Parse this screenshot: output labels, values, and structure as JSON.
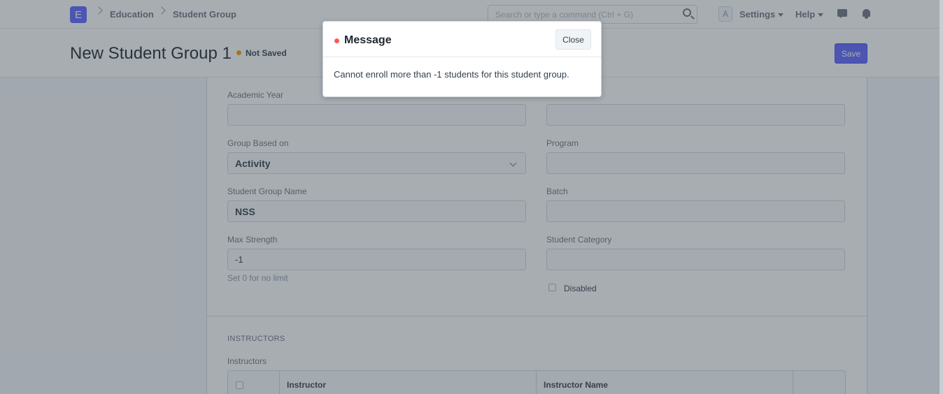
{
  "navbar": {
    "logo_letter": "E",
    "breadcrumbs": [
      "Education",
      "Student Group"
    ],
    "search_placeholder": "Search or type a command (Ctrl + G)",
    "avatar_letter": "A",
    "settings_label": "Settings",
    "help_label": "Help"
  },
  "page_head": {
    "title": "New Student Group 1",
    "status": "Not Saved",
    "save_label": "Save"
  },
  "form": {
    "academic_year": {
      "label": "Academic Year",
      "value": ""
    },
    "academic_term": {
      "label": "",
      "value": ""
    },
    "group_based_on": {
      "label": "Group Based on",
      "value": "Activity"
    },
    "program": {
      "label": "Program",
      "value": ""
    },
    "student_group_name": {
      "label": "Student Group Name",
      "value": "NSS"
    },
    "batch": {
      "label": "Batch",
      "value": ""
    },
    "max_strength": {
      "label": "Max Strength",
      "value": "-1",
      "help": "Set 0 for no limit"
    },
    "student_category": {
      "label": "Student Category",
      "value": ""
    },
    "disabled": {
      "label": "Disabled",
      "checked": false
    }
  },
  "instructors_section": {
    "heading": "INSTRUCTORS",
    "table_label": "Instructors",
    "columns": [
      "Instructor",
      "Instructor Name"
    ]
  },
  "modal": {
    "title": "Message",
    "close_label": "Close",
    "message": "Cannot enroll more than -1 students for this student group.",
    "indicator_color": "#ff5858"
  },
  "colors": {
    "primary": "#5e64ff",
    "status_not_saved": "#ff9c00"
  }
}
